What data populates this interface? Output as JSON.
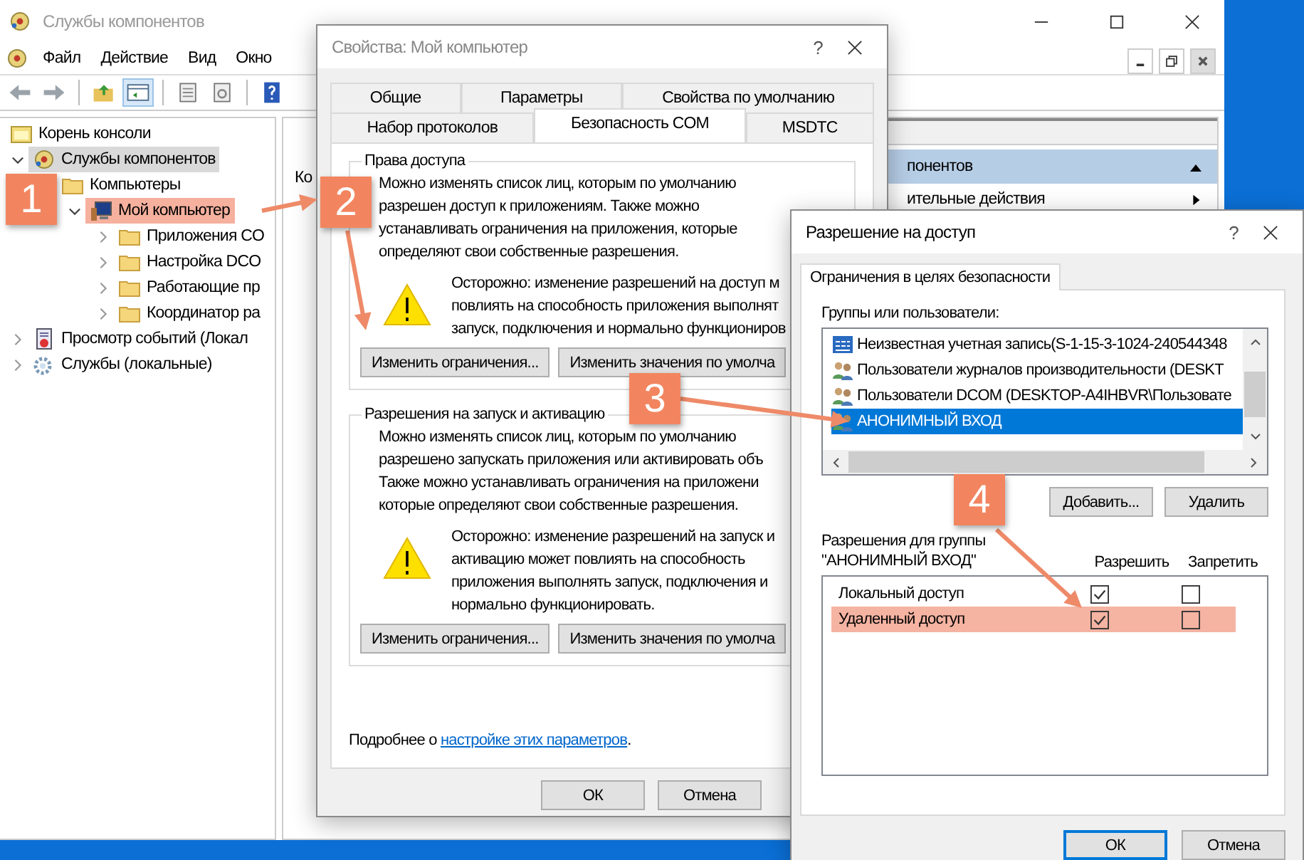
{
  "main_window": {
    "title": "Службы компонентов",
    "menu": [
      "Файл",
      "Действие",
      "Вид",
      "Окно"
    ],
    "tree": [
      {
        "label": "Корень консоли",
        "kind": "root",
        "children": [
          {
            "label": "Службы компонентов",
            "kind": "component",
            "expanded": true,
            "selected": true,
            "children": [
              {
                "label": "Компьютеры",
                "kind": "folder",
                "children": [
                  {
                    "label": "Мой компьютер",
                    "kind": "computer",
                    "expanded": true,
                    "highlighted": true,
                    "children": [
                      {
                        "label": "Приложения CO",
                        "kind": "folder",
                        "expanded": false
                      },
                      {
                        "label": "Настройка DCO",
                        "kind": "folder",
                        "expanded": false
                      },
                      {
                        "label": "Работающие пр",
                        "kind": "folder",
                        "expanded": false
                      },
                      {
                        "label": "Координатор ра",
                        "kind": "folder",
                        "expanded": false
                      }
                    ]
                  }
                ]
              }
            ]
          },
          {
            "label": "Просмотр событий (Локал",
            "kind": "events",
            "expanded": false
          },
          {
            "label": "Службы (локальные)",
            "kind": "services",
            "expanded": false
          }
        ]
      }
    ],
    "content_text": "Ко",
    "actions": [
      {
        "label": "понентов",
        "kind": "header"
      },
      {
        "label": "ительные действия",
        "kind": "item"
      }
    ]
  },
  "properties_dialog": {
    "title": "Свойства: Мой компьютер",
    "help": "?",
    "tab_rows": [
      [
        {
          "label": "Общие",
          "selected": false
        },
        {
          "label": "Параметры",
          "selected": false
        },
        {
          "label": "Свойства по умолчанию",
          "selected": false
        }
      ],
      [
        {
          "label": "Набор протоколов",
          "selected": false
        },
        {
          "label": "Безопасность COM",
          "selected": true
        },
        {
          "label": "MSDTC",
          "selected": false
        }
      ]
    ],
    "groups": [
      {
        "legend": "Права доступа",
        "lines": [
          "Можно изменять список лиц, которым по умолчанию",
          "разрешен доступ к приложениям. Также можно",
          "устанавливать ограничения на приложения, которые",
          "определяют свои собственные разрешения."
        ],
        "warning_lines": [
          "Осторожно: изменение разрешений на доступ м",
          "повлиять на способность приложения выполнят",
          "запуск, подключения и нормально функциониров"
        ],
        "buttons": [
          "Изменить ограничения...",
          "Изменить значения по умолча"
        ]
      },
      {
        "legend": "Разрешения на запуск и активацию",
        "lines": [
          "Можно изменять список лиц, которым по умолчанию",
          "разрешено запускать приложения или активировать объ",
          "Также можно устанавливать ограничения на приложени",
          "которые определяют свои собственные разрешения."
        ],
        "warning_lines": [
          "Осторожно: изменение разрешений на запуск и",
          "активацию может повлиять на способность",
          "приложения выполнять запуск, подключения и",
          "нормально функционировать."
        ],
        "buttons": [
          "Изменить ограничения...",
          "Изменить значения по умолча"
        ]
      }
    ],
    "footer": {
      "before": "Подробнее о ",
      "link": "настройке этих параметров",
      "after": "."
    },
    "buttons": [
      "ОК",
      "Отмена"
    ]
  },
  "access_dialog": {
    "title": "Разрешение на доступ",
    "help": "?",
    "tab": "Ограничения в целях безопасности",
    "users_label": "Группы или пользователи:",
    "users": [
      {
        "name": "Неизвестная учетная запись(S-1-15-3-1024-240544348",
        "kind": "account",
        "selected": false
      },
      {
        "name": "Пользователи журналов производительности (DESKT",
        "kind": "group",
        "selected": false
      },
      {
        "name": "Пользователи DCOM (DESKTOP-A4IHBVR\\Пользовате",
        "kind": "group",
        "selected": false
      },
      {
        "name": "АНОНИМНЫЙ ВХОД",
        "kind": "group",
        "selected": true
      }
    ],
    "user_buttons": [
      "Добавить...",
      "Удалить"
    ],
    "permissions_label": [
      "Разрешения для группы",
      "\"АНОНИМНЫЙ ВХОД\""
    ],
    "columns": [
      "Разрешить",
      "Запретить"
    ],
    "permissions": [
      {
        "name": "Локальный доступ",
        "allow": true,
        "deny": false,
        "highlighted": false
      },
      {
        "name": "Удаленный доступ",
        "allow": true,
        "deny": false,
        "highlighted": true
      }
    ],
    "buttons": [
      {
        "label": "ОК",
        "default": true
      },
      {
        "label": "Отмена",
        "default": false
      }
    ]
  },
  "annotations": [
    "1",
    "2",
    "3",
    "4"
  ]
}
